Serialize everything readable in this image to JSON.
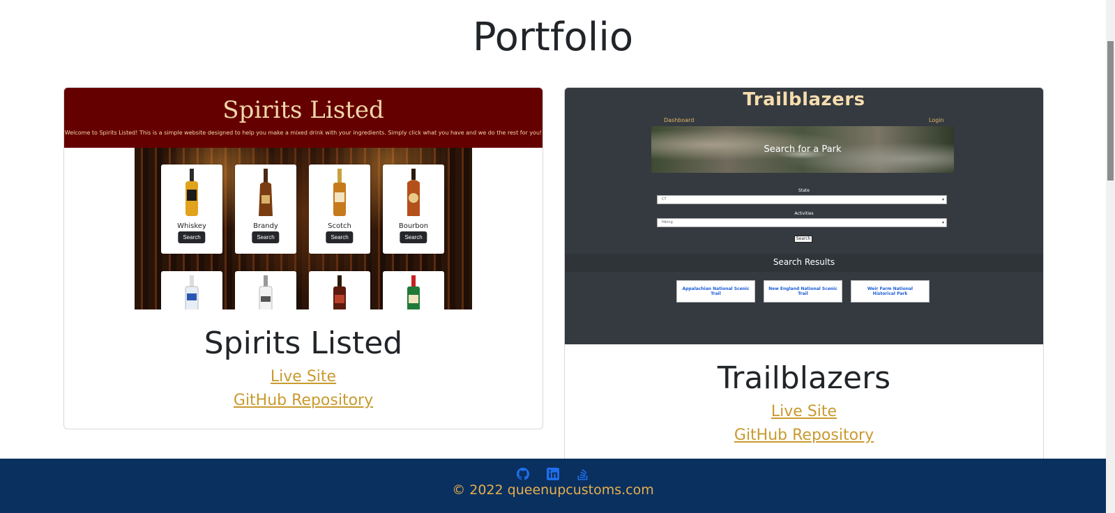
{
  "page": {
    "title": "Portfolio"
  },
  "projects": [
    {
      "name": "Spirits Listed",
      "live_label": "Live Site",
      "repo_label": "GitHub Repository",
      "preview": {
        "title": "Spirits Listed",
        "tagline": "Welcome to Spirits Listed! This is a simple website designed to help you make a mixed drink with your ingredients. Simply click what you have and we do the rest for you!",
        "drinks": [
          {
            "name": "Whiskey",
            "button": "Search"
          },
          {
            "name": "Brandy",
            "button": "Search"
          },
          {
            "name": "Scotch",
            "button": "Search"
          },
          {
            "name": "Bourbon",
            "button": "Search"
          }
        ]
      }
    },
    {
      "name": "Trailblazers",
      "live_label": "Live Site",
      "repo_label": "GitHub Repository",
      "preview": {
        "title": "Trailblazers",
        "nav_left": "Dashboard",
        "nav_right": "Login",
        "hero_text": "Search for a Park",
        "state_label": "State",
        "state_value": "CT",
        "activities_label": "Activities",
        "activities_value": "Hiking",
        "search_button": "Search",
        "results_title": "Search Results",
        "results": [
          "Appalachian National Scenic Trail",
          "New England National Scenic Trail",
          "Weir Farm National Historical Park"
        ]
      }
    }
  ],
  "footer": {
    "icons": [
      "github-icon",
      "linkedin-icon",
      "stackoverflow-icon"
    ],
    "copyright": "© 2022 queenupcustoms.com"
  },
  "colors": {
    "footer_bg": "#0a3060",
    "accent": "#c99a2e",
    "spirits_header": "#650000",
    "trail_bg": "#343a40"
  }
}
